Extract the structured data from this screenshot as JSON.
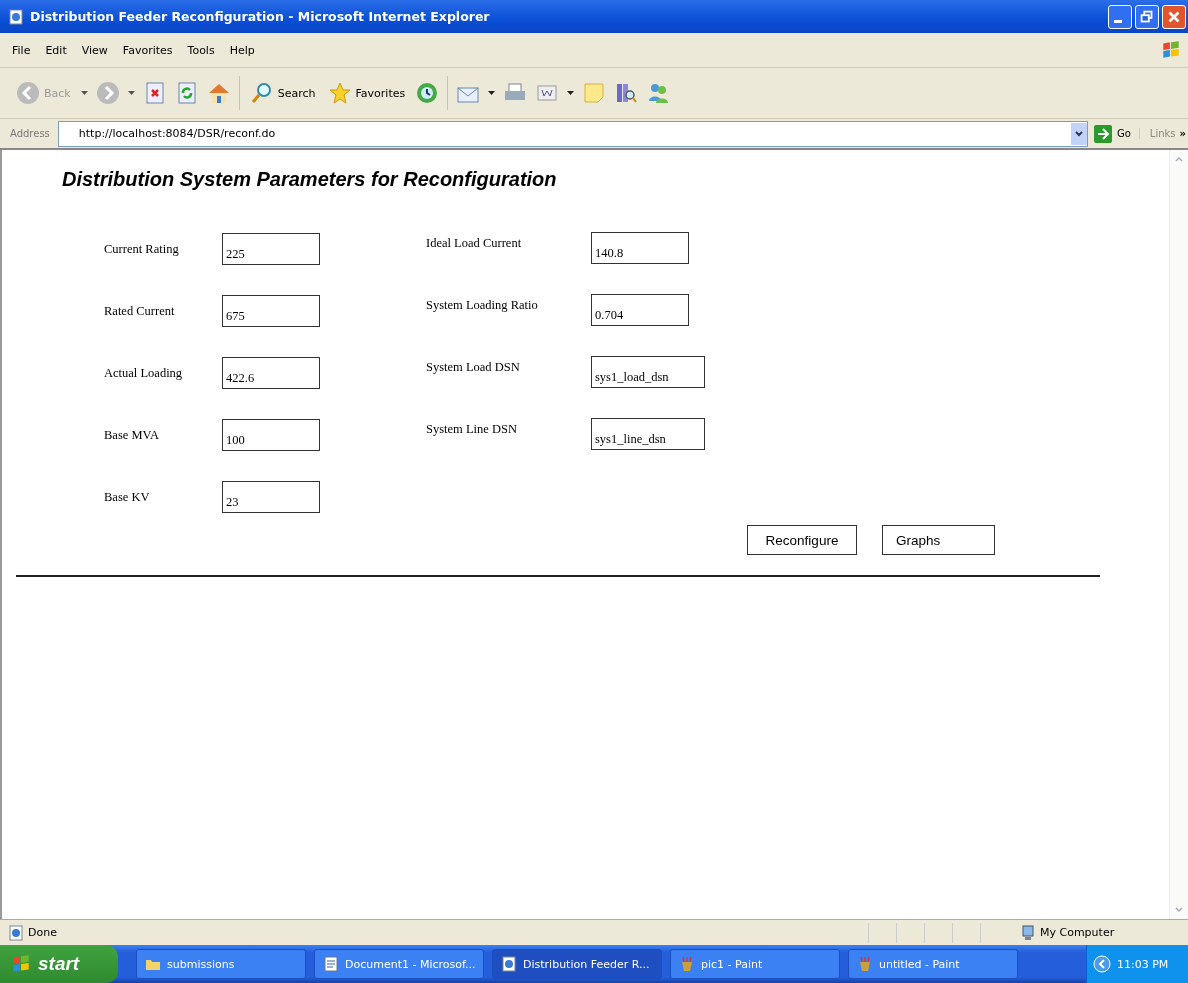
{
  "window": {
    "title": "Distribution Feeder Reconfiguration - Microsoft Internet Explorer"
  },
  "menu": [
    "File",
    "Edit",
    "View",
    "Favorites",
    "Tools",
    "Help"
  ],
  "toolbar": {
    "back": {
      "label": "Back",
      "disabled": true
    },
    "search": "Search",
    "favorites": "Favorites"
  },
  "address_bar": {
    "label": "Address",
    "url": "http://localhost:8084/DSR/reconf.do",
    "go": "Go",
    "links": "Links",
    "more": "»"
  },
  "page": {
    "heading": "Distribution System Parameters for Reconfiguration",
    "fields_left": [
      {
        "label": "Current Rating",
        "value": "225"
      },
      {
        "label": "Rated Current",
        "value": "675"
      },
      {
        "label": "Actual Loading",
        "value": "422.6"
      },
      {
        "label": "Base MVA",
        "value": "100"
      },
      {
        "label": "Base KV",
        "value": "23"
      }
    ],
    "fields_right": [
      {
        "label": "Ideal Load Current",
        "value": "140.8"
      },
      {
        "label": "System Loading Ratio",
        "value": "0.704"
      },
      {
        "label": "System Load DSN",
        "value": "sys1_load_dsn"
      },
      {
        "label": "System Line DSN",
        "value": "sys1_line_dsn"
      }
    ],
    "buttons": [
      "Reconfigure",
      "Graphs"
    ]
  },
  "status_bar": {
    "text": "Done",
    "zone": "My Computer"
  },
  "taskbar": {
    "start": "start",
    "items": [
      {
        "label": "submissions",
        "kind": "folder",
        "selected": false
      },
      {
        "label": "Document1 - Microsof...",
        "kind": "document",
        "selected": false
      },
      {
        "label": "Distribution Feeder R...",
        "kind": "browser",
        "selected": true
      },
      {
        "label": "pic1 - Paint",
        "kind": "paint",
        "selected": false
      },
      {
        "label": "untitled - Paint",
        "kind": "paint",
        "selected": false
      }
    ],
    "clock": "11:03 PM"
  }
}
